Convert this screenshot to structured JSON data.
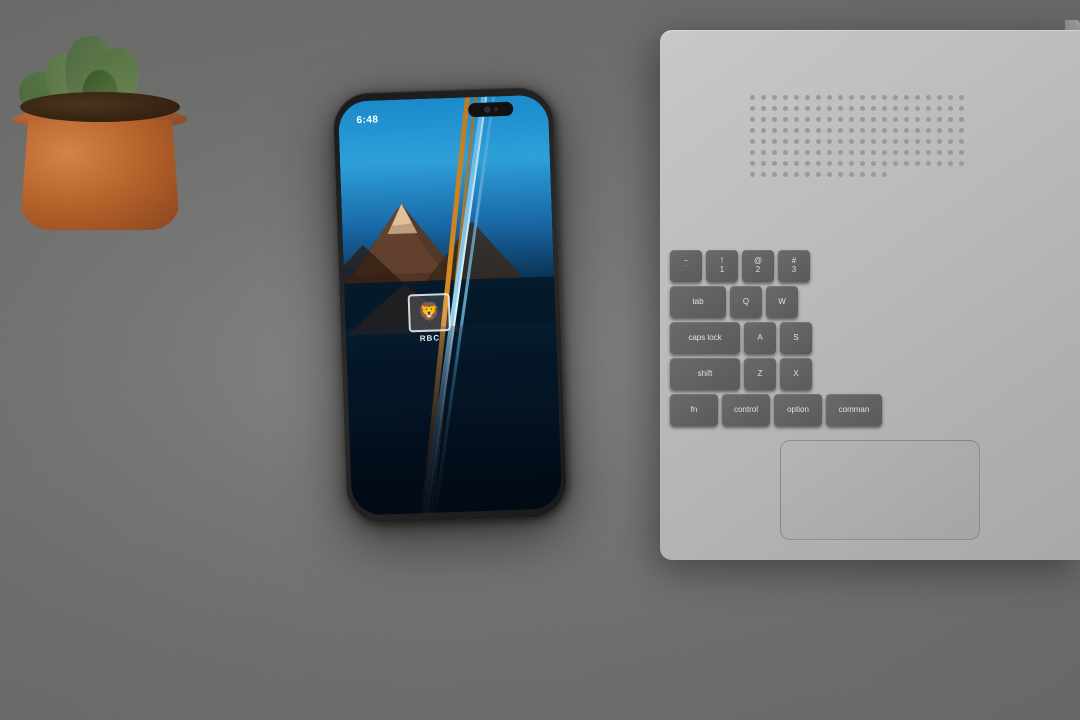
{
  "scene": {
    "description": "Desk scene with smartphone, laptop, and succulent plant",
    "background_color": "#7a7a78"
  },
  "phone": {
    "time": "6:48",
    "app": "RBC",
    "app_label": "RBC",
    "wallpaper": "mountain lake landscape",
    "lines": [
      "orange",
      "blue",
      "white"
    ]
  },
  "keyboard": {
    "rows": [
      [
        "~",
        "1",
        "2",
        "3"
      ],
      [
        "tab",
        "Q",
        "W"
      ],
      [
        "caps lock",
        "A",
        "S"
      ],
      [
        "shift",
        "Z",
        "X"
      ],
      [
        "fn",
        "control",
        "option",
        "comman"
      ]
    ]
  },
  "detected_text": {
    "option_key": "option"
  }
}
